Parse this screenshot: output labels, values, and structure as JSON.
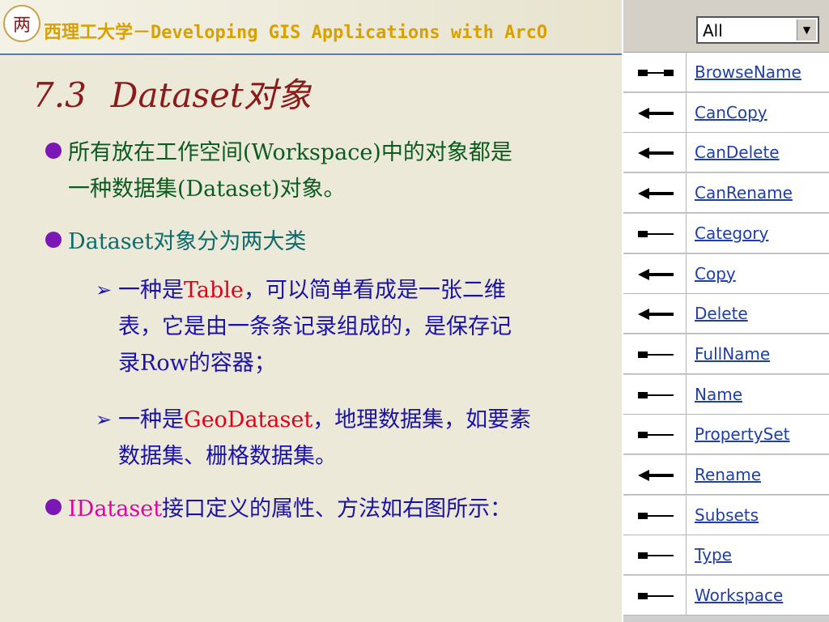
{
  "header": {
    "logo_text": "两",
    "title": "西理工大学－Developing GIS Applications with ArcO"
  },
  "slide": {
    "title_number": "7.3",
    "title_text": "Dataset对象"
  },
  "bullets": [
    {
      "parts": [
        "所有放在工作空间(Workspace)中的对象都是",
        "一种数据集(Dataset)对象。"
      ]
    },
    {
      "parts": [
        "Dataset对象分为两大类"
      ]
    },
    {
      "parts": [
        "一种是",
        "Table",
        "，可以简单看成是一张二维",
        "表，它是由一条条记录组成的，是保存记",
        "录Row的容器；"
      ]
    },
    {
      "parts": [
        "一种是",
        "GeoDataset",
        "，地理数据集，如要素",
        "数据集、栅格数据集。"
      ]
    },
    {
      "parts": [
        "IDataset",
        "接口定义的属性、方法如右图所示："
      ]
    }
  ],
  "panel": {
    "filter_value": "All",
    "members": [
      {
        "name": "BrowseName",
        "icon": "read-write-property-icon"
      },
      {
        "name": "CanCopy",
        "icon": "method-arrow-icon"
      },
      {
        "name": "CanDelete",
        "icon": "method-arrow-icon"
      },
      {
        "name": "CanRename",
        "icon": "method-arrow-icon"
      },
      {
        "name": "Category",
        "icon": "read-only-property-icon"
      },
      {
        "name": "Copy",
        "icon": "method-arrow-icon"
      },
      {
        "name": "Delete",
        "icon": "method-arrow-icon"
      },
      {
        "name": "FullName",
        "icon": "read-only-property-icon"
      },
      {
        "name": "Name",
        "icon": "read-only-property-icon"
      },
      {
        "name": "PropertySet",
        "icon": "read-only-property-icon"
      },
      {
        "name": "Rename",
        "icon": "method-arrow-icon"
      },
      {
        "name": "Subsets",
        "icon": "read-only-property-icon"
      },
      {
        "name": "Type",
        "icon": "read-only-property-icon"
      },
      {
        "name": "Workspace",
        "icon": "read-only-property-icon"
      }
    ]
  },
  "colors": {
    "title": "#8b1a1a",
    "bullet_dot": "#7a17b5",
    "link": "#1f3fa6",
    "highlight_red": "#e0001a",
    "highlight_magenta": "#e000a8"
  }
}
